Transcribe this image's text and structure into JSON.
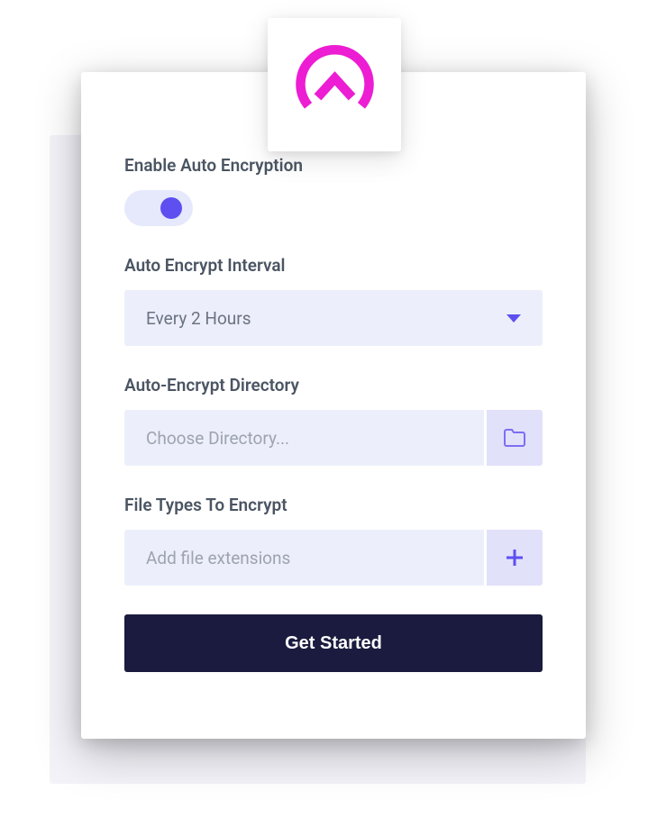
{
  "enable_encryption": {
    "label": "Enable Auto Encryption",
    "toggle_state": "on"
  },
  "interval": {
    "label": "Auto Encrypt Interval",
    "value": "Every 2 Hours"
  },
  "directory": {
    "label": "Auto-Encrypt Directory",
    "placeholder": "Choose Directory..."
  },
  "file_types": {
    "label": "File Types To Encrypt",
    "placeholder": "Add file extensions"
  },
  "cta": {
    "label": "Get Started"
  }
}
